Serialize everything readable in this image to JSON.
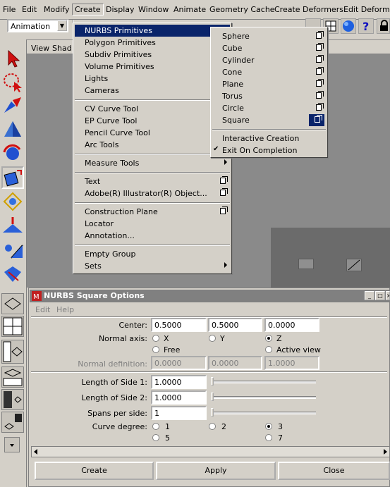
{
  "menubar": {
    "items": [
      "File",
      "Edit",
      "Modify",
      "Create",
      "Display",
      "Window",
      "Animate",
      "Geometry Cache",
      "Create Deformers",
      "Edit Deformer"
    ]
  },
  "toolbar": {
    "mode": "Animation"
  },
  "viewport": {
    "menu": [
      "View",
      "Shad"
    ]
  },
  "create_menu": {
    "items": [
      {
        "label": "NURBS Primitives",
        "submenu": true,
        "highlighted": true
      },
      {
        "label": "Polygon Primitives",
        "submenu": true
      },
      {
        "label": "Subdiv Primitives",
        "submenu": true
      },
      {
        "label": "Volume Primitives",
        "submenu": true
      },
      {
        "label": "Lights",
        "submenu": true
      },
      {
        "label": "Cameras",
        "submenu": true
      },
      {
        "label": "CV Curve Tool",
        "option": false
      },
      {
        "label": "EP Curve Tool"
      },
      {
        "label": "Pencil Curve Tool"
      },
      {
        "label": "Arc Tools",
        "submenu": true
      },
      {
        "label": "Measure Tools",
        "submenu": true
      },
      {
        "label": "Text",
        "option": true
      },
      {
        "label": "Adobe(R) Illustrator(R) Object...",
        "option": true
      },
      {
        "label": "Construction Plane",
        "option": true
      },
      {
        "label": "Locator"
      },
      {
        "label": "Annotation..."
      },
      {
        "label": "Empty Group"
      },
      {
        "label": "Sets",
        "submenu": true
      }
    ]
  },
  "nurbs_submenu": {
    "items": [
      "Sphere",
      "Cube",
      "Cylinder",
      "Cone",
      "Plane",
      "Torus",
      "Circle",
      "Square"
    ],
    "highlighted": "Square",
    "interactive_creation": "Interactive Creation",
    "exit_on_completion": "Exit On Completion",
    "exit_checked": true,
    "check_glyph": "✔"
  },
  "dialog": {
    "title": "NURBS Square Options",
    "menu": [
      "Edit",
      "Help"
    ],
    "center_label": "Center:",
    "center": [
      "0.5000",
      "0.5000",
      "0.0000"
    ],
    "normal_axis_label": "Normal axis:",
    "normal_axis_options": [
      "X",
      "Y",
      "Z",
      "Free",
      "Active view"
    ],
    "normal_axis_selected": "Z",
    "normal_definition_label": "Normal definition:",
    "normal_definition": [
      "0.0000",
      "0.0000",
      "1.0000"
    ],
    "length1_label": "Length of Side 1:",
    "length1": "1.0000",
    "length2_label": "Length of Side 2:",
    "length2": "1.0000",
    "spans_label": "Spans per side:",
    "spans": "1",
    "curve_degree_label": "Curve degree:",
    "curve_degree_options": [
      "1",
      "2",
      "3",
      "5",
      "7"
    ],
    "curve_degree_selected": "3",
    "buttons": {
      "create": "Create",
      "apply": "Apply",
      "close": "Close"
    }
  },
  "colors": {
    "menu_highlight": "#0a246a",
    "titlebar": "#808080",
    "viewport": "#8a8a8a"
  }
}
